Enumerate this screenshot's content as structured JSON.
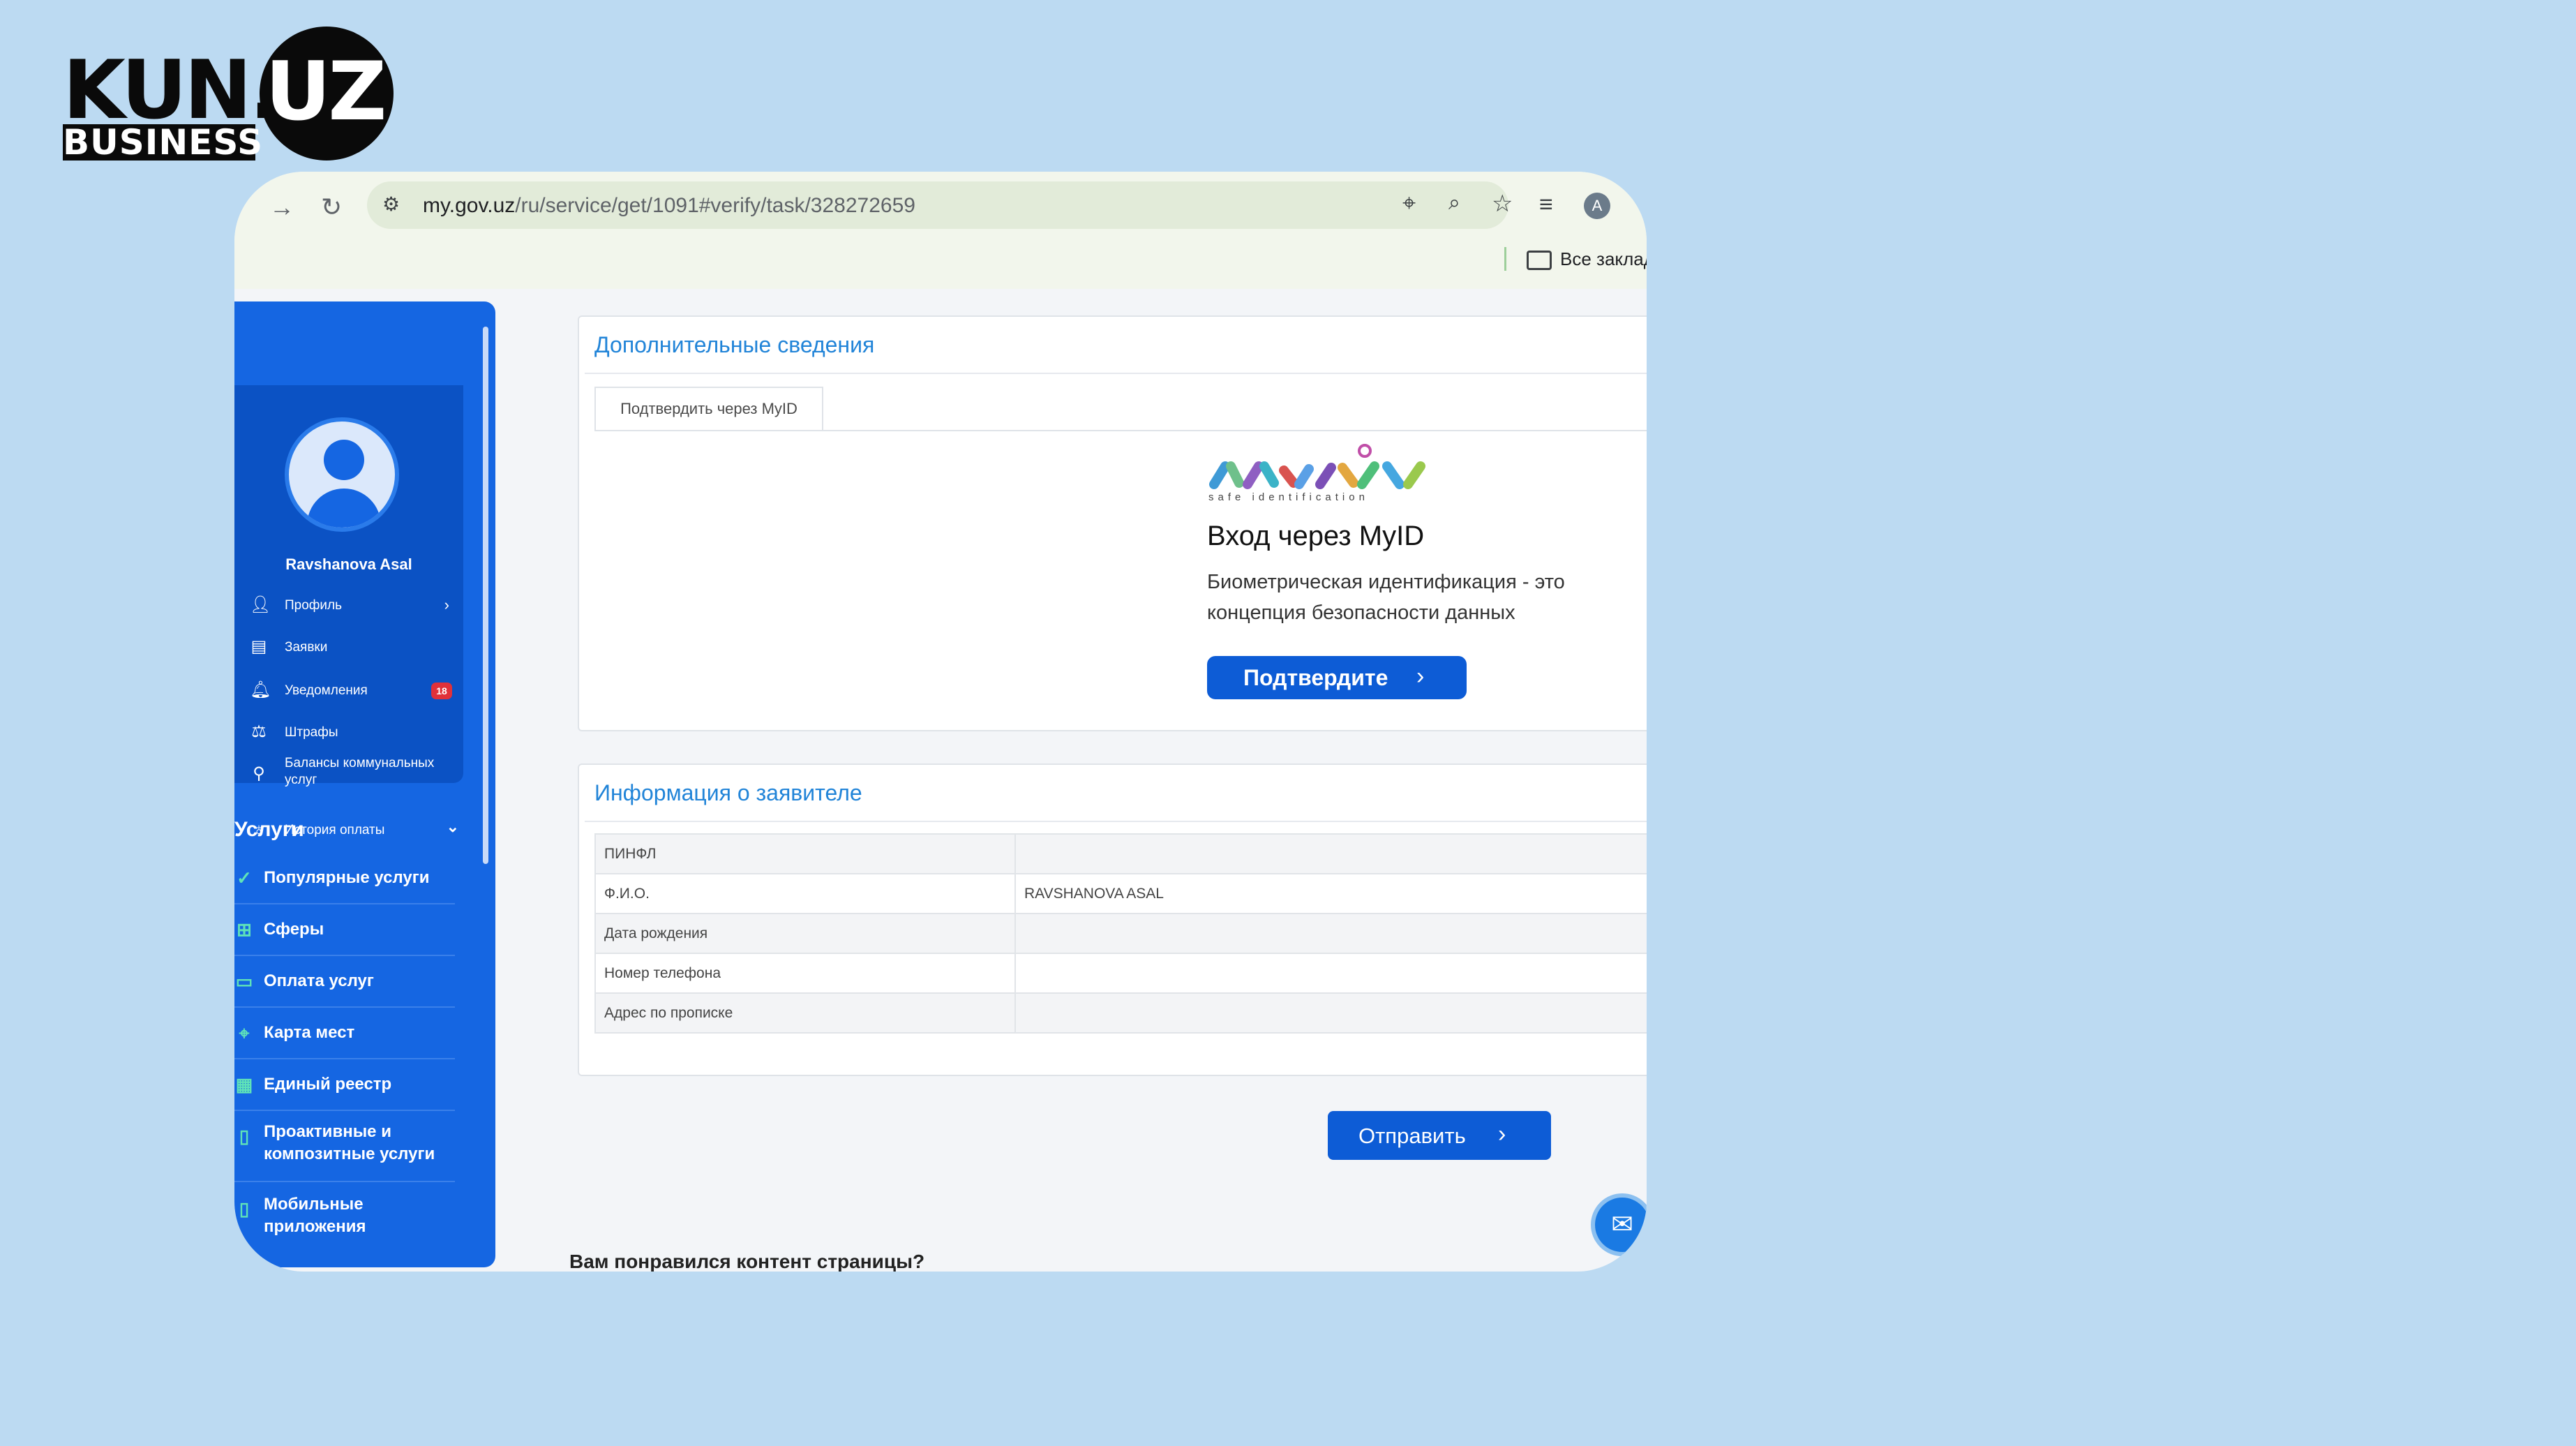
{
  "watermark": {
    "kun": "KUN.",
    "uz": "UZ",
    "business": "BUSINESS"
  },
  "browser": {
    "url_domain": "my.gov.uz",
    "url_path": "/ru/service/get/1091#verify/task/328272659",
    "avatar_letter": "A",
    "bookmarks_label": "Все заклад"
  },
  "sidebar": {
    "user_name": "Ravshanova Asal",
    "menu": [
      {
        "label": "Профиль",
        "icon": "person-icon"
      },
      {
        "label": "Заявки",
        "icon": "document-list-icon"
      },
      {
        "label": "Уведомления",
        "icon": "bell-icon",
        "badge": "18"
      },
      {
        "label": "Штрафы",
        "icon": "fines-icon"
      },
      {
        "label": "Балансы коммунальных услуг",
        "icon": "utilities-icon"
      },
      {
        "label": "История оплаты",
        "icon": "wallet-icon"
      }
    ],
    "services_title": "Услуги",
    "services": [
      {
        "label": "Популярные услуги",
        "icon": "badge-check-icon"
      },
      {
        "label": "Сферы",
        "icon": "grid-icon"
      },
      {
        "label": "Оплата услуг",
        "icon": "card-icon"
      },
      {
        "label": "Карта мест",
        "icon": "map-pin-icon"
      },
      {
        "label": "Единый реестр",
        "icon": "registry-icon"
      },
      {
        "label": "Проактивные и композитные услуги",
        "icon": "file-icon"
      },
      {
        "label": "Мобильные приложения",
        "icon": "phone-icon"
      }
    ]
  },
  "additional": {
    "title": "Дополнительные сведения",
    "tab_label": "Подтвердить через MyID",
    "myid_subtitle": "safe identification",
    "login_title": "Вход через MyID",
    "login_desc_line1": "Биометрическая идентификация - это",
    "login_desc_line2": "концепция безопасности данных",
    "confirm_button": "Подтвердите"
  },
  "applicant": {
    "title": "Информация о заявителе",
    "rows": [
      {
        "key": "ПИНФЛ",
        "value": ""
      },
      {
        "key": "Ф.И.О.",
        "value": "RAVSHANOVA ASAL"
      },
      {
        "key": "Дата рождения",
        "value": ""
      },
      {
        "key": "Номер телефона",
        "value": ""
      },
      {
        "key": "Адрес по прописке",
        "value": ""
      }
    ]
  },
  "submit_button": "Отправить",
  "feedback_question": "Вам понравился контент страницы?",
  "colors": {
    "primary": "#1566e2",
    "button": "#0d5cd6",
    "title_blue": "#2184d8",
    "badge_red": "#e0313a",
    "accent_green": "#5fe3b8"
  }
}
